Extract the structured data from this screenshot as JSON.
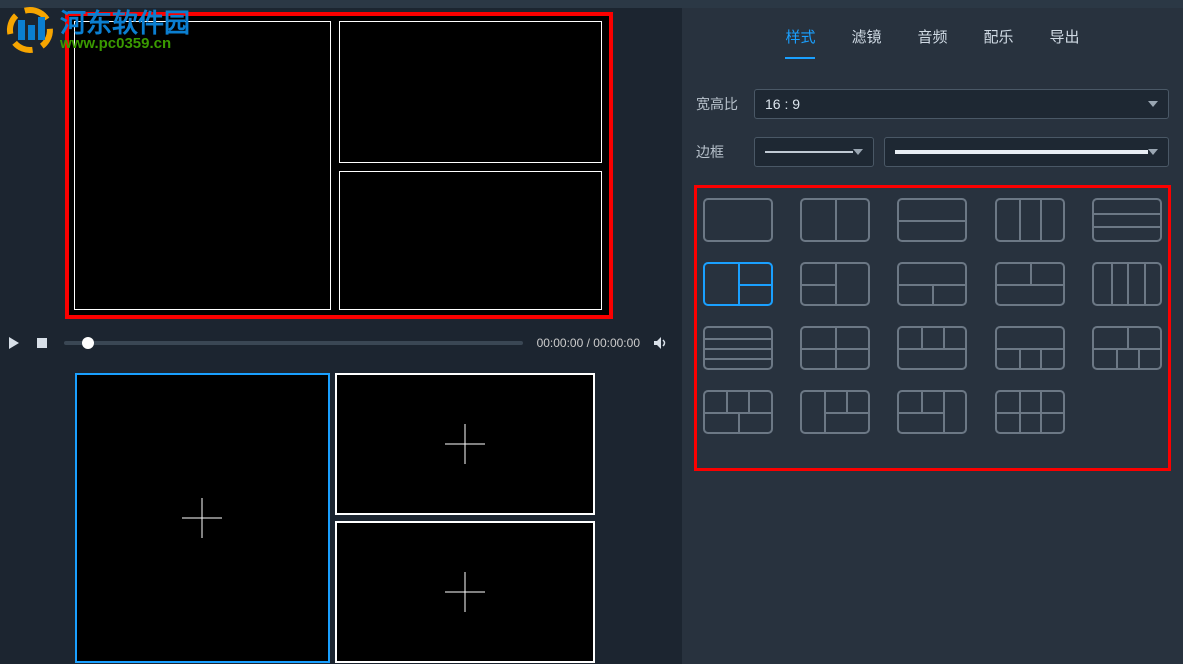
{
  "watermark": {
    "title": "河东软件园",
    "url": "www.pc0359.cn"
  },
  "tabs": [
    {
      "label": "样式",
      "active": true
    },
    {
      "label": "滤镜",
      "active": false
    },
    {
      "label": "音频",
      "active": false
    },
    {
      "label": "配乐",
      "active": false
    },
    {
      "label": "导出",
      "active": false
    }
  ],
  "aspect": {
    "label": "宽高比",
    "value": "16 : 9"
  },
  "border": {
    "label": "边框"
  },
  "playback": {
    "time": "00:00:00 / 00:00:00"
  }
}
